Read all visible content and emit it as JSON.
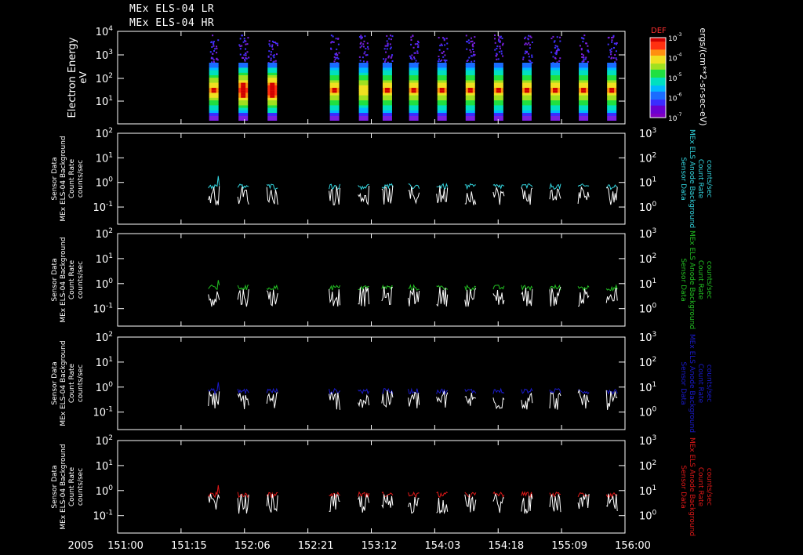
{
  "title_lines": [
    "MEx ELS-04 LR",
    "MEx ELS-04 HR"
  ],
  "colors": {
    "background": "#000000",
    "foreground": "#ffffff",
    "cyan": "#33d6e0",
    "green": "#22c022",
    "blue": "#1a1acc",
    "red": "#e01818",
    "white_trace": "#ffffff"
  },
  "x_axis": {
    "year_label": "2005",
    "tick_labels": [
      "151:00",
      "151:15",
      "152:06",
      "152:21",
      "153:12",
      "154:03",
      "154:18",
      "155:09",
      "156:00"
    ],
    "range": [
      "151:00",
      "156:00"
    ]
  },
  "spectrogram": {
    "ylabel": "Electron Energy",
    "yunit": "eV",
    "ytick_labels": [
      "10",
      "10",
      "10",
      "10"
    ],
    "ytick_exps": [
      "4",
      "3",
      "2",
      "1"
    ],
    "colorbar_title": "DEF",
    "colorbar_unit": "ergs/(cm**2-sr-sec-eV)",
    "colorbar_tick_labels": [
      "10",
      "10",
      "10",
      "10",
      "10"
    ],
    "colorbar_tick_exps": [
      "-3",
      "-4",
      "-5",
      "-6",
      "-7"
    ],
    "passes": [
      {
        "x": 0.255,
        "peak": 0.6
      },
      {
        "x": 0.333,
        "peak": 0.85
      },
      {
        "x": 0.41,
        "peak": 0.95
      },
      {
        "x": 0.575,
        "peak": 0.55
      },
      {
        "x": 0.652,
        "peak": 0.5
      },
      {
        "x": 0.715,
        "peak": 0.55
      },
      {
        "x": 0.785,
        "peak": 0.55
      },
      {
        "x": 0.86,
        "peak": 0.55
      },
      {
        "x": 0.935,
        "peak": 0.55
      },
      {
        "x": 1.01,
        "peak": 0.55
      },
      {
        "x": 1.085,
        "peak": 0.55
      },
      {
        "x": 1.16,
        "peak": 0.55
      },
      {
        "x": 1.235,
        "peak": 0.55
      },
      {
        "x": 1.31,
        "peak": 0.55
      }
    ]
  },
  "panel_labels": {
    "left": [
      "Sensor Data",
      "MEx ELS-04 Background",
      "Count Rate",
      "counts/sec"
    ],
    "right": [
      "Sensor Data",
      "MEx ELS Anode Background",
      "Count Rate",
      "counts/sec"
    ]
  },
  "panels": [
    {
      "color_key": "cyan"
    },
    {
      "color_key": "green"
    },
    {
      "color_key": "blue"
    },
    {
      "color_key": "red"
    }
  ],
  "left_ytick_labels": [
    "10",
    "10",
    "10",
    "10"
  ],
  "left_ytick_exps": [
    "2",
    "1",
    "0",
    "-1"
  ],
  "right_ytick_labels": [
    "10",
    "10",
    "10",
    "10"
  ],
  "right_ytick_exps": [
    "3",
    "2",
    "1",
    "0"
  ],
  "chart_data": {
    "type": "heatmap",
    "panels": [
      "Electron Energy spectrogram (DEF)",
      "Background count rate (cyan)",
      "Background count rate (green)",
      "Background count rate (blue)",
      "Background count rate (red)"
    ],
    "x_range": [
      "151:00",
      "156:00"
    ],
    "spectrogram_ylim": [
      20,
      10000
    ],
    "spectrogram_yscale": "log",
    "colorbar_range": [
      1e-07,
      0.001
    ],
    "left_ylim": [
      0.01,
      100
    ],
    "right_ylim": [
      0.1,
      1000
    ],
    "yscale": "log",
    "pass_times_fraction_of_range": [
      0.255,
      0.333,
      0.41,
      0.575,
      0.652,
      0.715,
      0.785,
      0.86,
      0.935,
      1.01,
      1.085,
      1.16,
      1.235,
      1.31
    ],
    "anode_rate_typical": 0.7,
    "white_rate_typical": 0.3
  }
}
